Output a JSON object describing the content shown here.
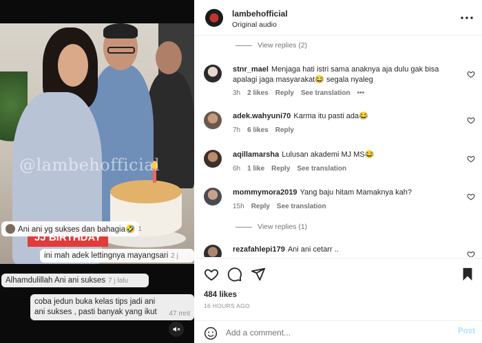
{
  "header": {
    "username": "lambehofficial",
    "audio": "Original audio",
    "more_icon": "more-horizontal-icon"
  },
  "video": {
    "watermark": "@lambehofficial",
    "tag": "JJ BIRTHDAY",
    "mute_icon": "muted-speaker-icon",
    "overlay_comments": [
      {
        "text": "Ani ani yg sukses dan bahagia🤣",
        "time": "1"
      },
      {
        "text": "ini mah adek lettingnya mayangsari",
        "time": "2 j"
      },
      {
        "text": "Alhamdulillah Ani ani sukses",
        "time": "7 j lalu"
      },
      {
        "text": "coba jedun buka kelas tips jadi ani ani sukses , pasti banyak yang ikut",
        "time": "47 mnt"
      }
    ]
  },
  "comments": {
    "view_replies_1": "View replies (2)",
    "view_replies_2": "View replies (1)",
    "items": [
      {
        "user": "stnr_mael",
        "text": "Menjaga hati istri sama anaknya aja dulu gak bisa apalagi jaga masyarakat😂 segala nyaleg",
        "time": "3h",
        "likes": "2 likes",
        "reply": "Reply",
        "translation": "See translation",
        "more": "•••"
      },
      {
        "user": "adek.wahyuni70",
        "text": "Karma itu pasti ada😂",
        "time": "7h",
        "likes": "6 likes",
        "reply": "Reply"
      },
      {
        "user": "aqillamarsha",
        "text": "Lulusan akademi MJ MS😂",
        "time": "6h",
        "likes": "1 like",
        "reply": "Reply",
        "translation": "See translation"
      },
      {
        "user": "mommymora2019",
        "text": "Yang baju hitam Mamaknya kah?",
        "time": "15h",
        "reply": "Reply",
        "translation": "See translation"
      },
      {
        "user": "rezafahlepi179",
        "text": "Ani ani cetarr ..",
        "time": ""
      }
    ]
  },
  "actions": {
    "likes": "484 likes",
    "posted": "16 HOURS AGO",
    "icons": [
      "heart-icon",
      "comment-icon",
      "share-icon",
      "bookmark-icon"
    ]
  },
  "add_comment": {
    "placeholder": "Add a comment...",
    "post_label": "Post"
  }
}
